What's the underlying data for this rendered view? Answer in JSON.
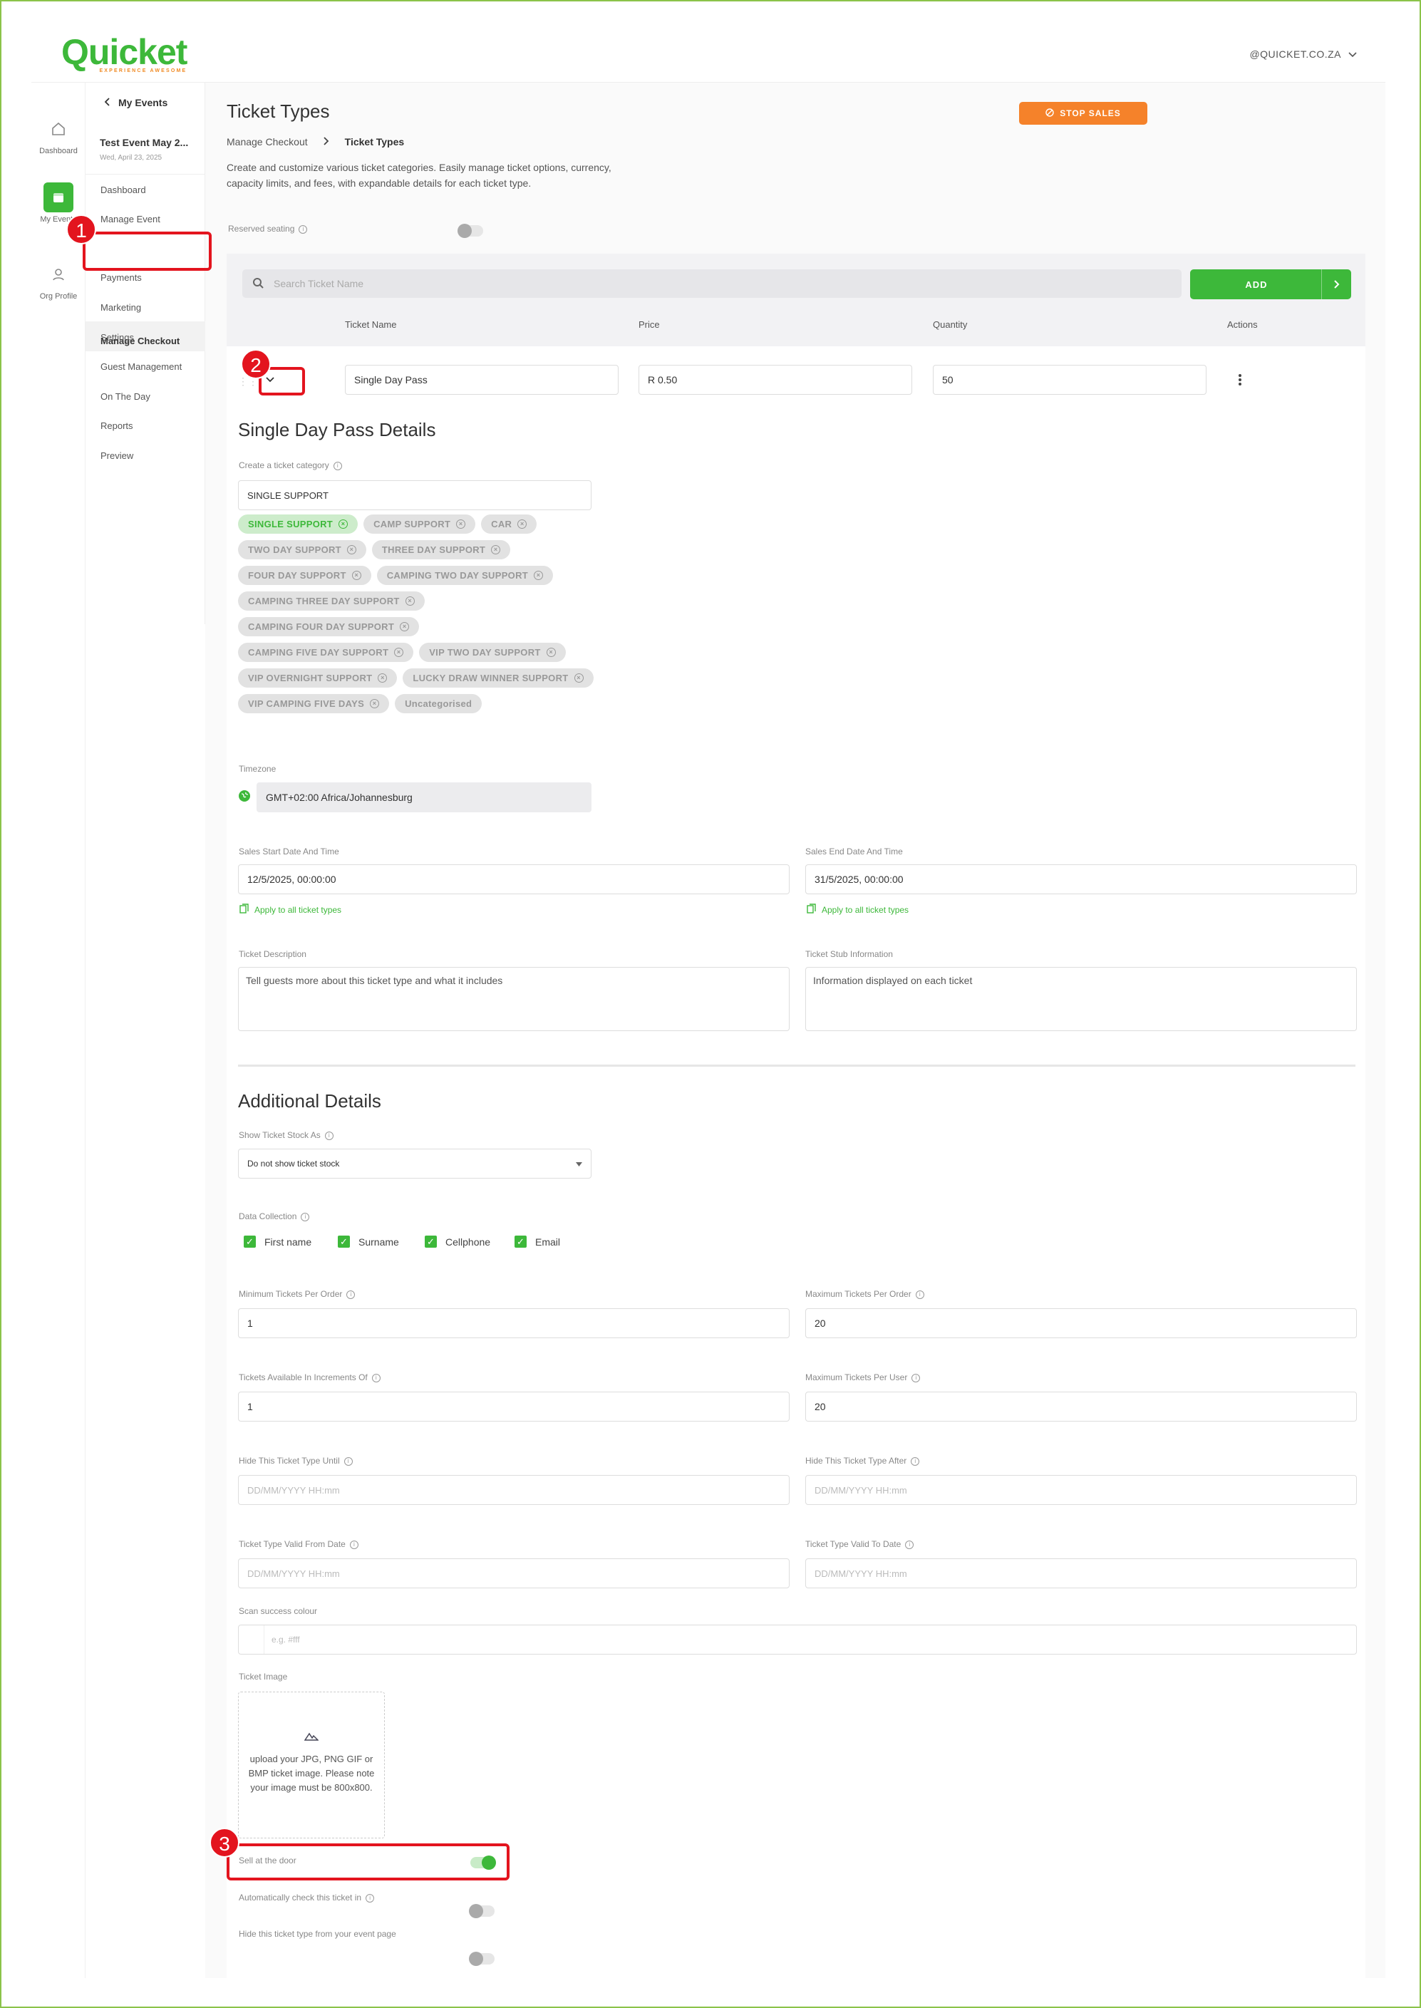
{
  "header": {
    "logo": "Quicket",
    "logo_tagline": "EXPERIENCE AWESOME",
    "account": "@QUICKET.CO.ZA"
  },
  "rail": [
    {
      "label": "Dashboard",
      "icon": "home-icon"
    },
    {
      "label": "My Events",
      "icon": "calendar-icon"
    },
    {
      "label": "Org Profile",
      "icon": "user-icon"
    }
  ],
  "sidebar": {
    "back_label": "My Events",
    "event_title": "Test Event May 2...",
    "event_date": "Wed, April 23, 2025",
    "items": [
      "Dashboard",
      "Manage Event",
      "Manage Checkout",
      "Payments",
      "Marketing",
      "Settings",
      "Guest Management",
      "On The Day",
      "Reports",
      "Preview"
    ]
  },
  "page": {
    "title": "Ticket Types",
    "stop_sales": "STOP SALES",
    "breadcrumb": [
      "Manage Checkout",
      "Ticket Types"
    ],
    "intro": "Create and customize various ticket categories. Easily manage ticket options, currency, capacity limits, and fees, with expandable details for each ticket type.",
    "reserved_seating": "Reserved seating"
  },
  "table": {
    "search_placeholder": "Search Ticket Name",
    "add_label": "ADD",
    "headers": [
      "Ticket Name",
      "Price",
      "Quantity",
      "Actions"
    ],
    "row": {
      "name": "Single Day Pass",
      "price": "R 0.50",
      "quantity": "50"
    }
  },
  "details": {
    "heading": "Single Day Pass Details",
    "category_label": "Create a ticket category",
    "category_value": "SINGLE SUPPORT",
    "categories": [
      "SINGLE SUPPORT",
      "CAMP SUPPORT",
      "CAR",
      "TWO DAY SUPPORT",
      "THREE DAY SUPPORT",
      "FOUR DAY SUPPORT",
      "CAMPING TWO DAY SUPPORT",
      "CAMPING THREE DAY SUPPORT",
      "CAMPING FOUR DAY SUPPORT",
      "CAMPING FIVE DAY SUPPORT",
      "VIP TWO DAY SUPPORT",
      "VIP OVERNIGHT SUPPORT",
      "LUCKY DRAW WINNER SUPPORT",
      "VIP CAMPING FIVE DAYS",
      "Uncategorised"
    ],
    "selected_category": "SINGLE SUPPORT",
    "timezone_label": "Timezone",
    "timezone": "GMT+02:00 Africa/Johannesburg",
    "sales_start_label": "Sales Start Date And Time",
    "sales_start": "12/5/2025, 00:00:00",
    "sales_end_label": "Sales End Date And Time",
    "sales_end": "31/5/2025, 00:00:00",
    "apply_all": "Apply to all ticket types",
    "desc_label": "Ticket Description",
    "desc_placeholder": "Tell guests more about this ticket type and what it includes",
    "stub_label": "Ticket Stub Information",
    "stub_placeholder": "Information displayed on each ticket"
  },
  "additional": {
    "heading": "Additional Details",
    "stock_label": "Show Ticket Stock As",
    "stock_value": "Do not show ticket stock",
    "data_collection_label": "Data Collection",
    "data_fields": [
      "First name",
      "Surname",
      "Cellphone",
      "Email"
    ],
    "min_label": "Minimum Tickets Per Order",
    "min_value": "1",
    "max_label": "Maximum Tickets Per Order",
    "max_value": "20",
    "incr_label": "Tickets Available In Increments Of",
    "incr_value": "1",
    "max_user_label": "Maximum Tickets Per User",
    "max_user_value": "20",
    "hide_until_label": "Hide This Ticket Type Until",
    "hide_after_label": "Hide This Ticket Type After",
    "valid_from_label": "Ticket Type Valid From Date",
    "valid_to_label": "Ticket Type Valid To Date",
    "date_placeholder": "DD/MM/YYYY HH:mm",
    "scan_label": "Scan success colour",
    "scan_placeholder": "e.g. #fff",
    "image_label": "Ticket Image",
    "upload_text": "upload your JPG, PNG GIF or BMP ticket image. Please note your image must be 800x800.",
    "sell_door": "Sell at the door",
    "auto_checkin": "Automatically check this ticket in",
    "hide_event_page": "Hide this ticket type from your event page"
  },
  "annotations": [
    "1",
    "2",
    "3"
  ],
  "colors": {
    "brand": "#3db83a",
    "stop": "#f5822a",
    "annotation": "#e3141e"
  }
}
